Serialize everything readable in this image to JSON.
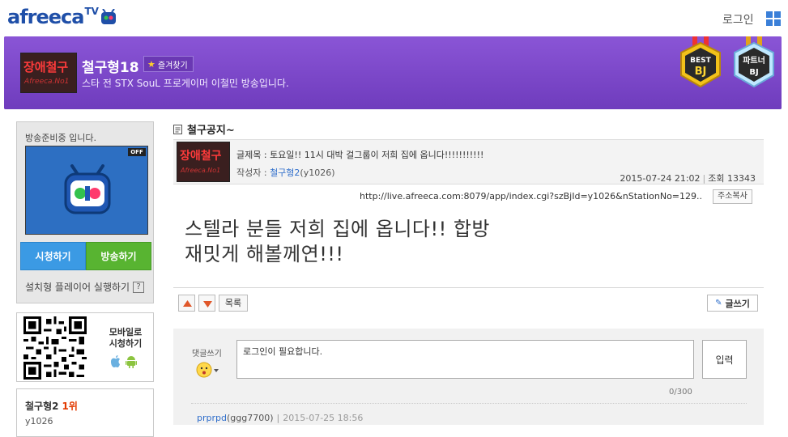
{
  "header": {
    "logo_text": "afreeca",
    "logo_tv": "TV",
    "login_label": "로그인"
  },
  "channel": {
    "thumb_line1": "장애철구",
    "thumb_line2": "Afreeca.No1",
    "name": "철구형18",
    "favorite_label": "즐겨찾기",
    "description": "스타 전 STX SouL 프로게이머 이철민 방송입니다.",
    "badge_best_line1": "BEST",
    "badge_best_line2": "BJ",
    "badge_partner_line1": "파트너",
    "badge_partner_line2": "BJ"
  },
  "sidebar": {
    "player_status": "방송준비중 입니다.",
    "off_label": "OFF",
    "watch_label": "시청하기",
    "broadcast_label": "방송하기",
    "install_player_label": "설치형 플레이어 실행하기",
    "help_label": "?",
    "mobile_line1": "모바일로",
    "mobile_line2": "시청하기",
    "rank_name": "철구형2",
    "rank_position": "1위",
    "rank_id": "y1026"
  },
  "board": {
    "title": "철구공지~",
    "subject_label": "글제목 : ",
    "subject": "토요일!! 11시 대박 걸그룹이 저희 집에 옵니다!!!!!!!!!!!",
    "author_label": "작성자 : ",
    "author_nick": "철구형2",
    "author_id": "(y1026)",
    "date": "2015-07-24 21:02",
    "views_label": "조회",
    "views": "13343",
    "url": "http://live.afreeca.com:8079/app/index.cgi?szBjId=y1026&nStationNo=129..",
    "copy_label": "주소복사",
    "body_line1": "스텔라 분들 저희 집에 옵니다!! 합방",
    "body_line2": "재밋게 해볼께연!!!",
    "list_label": "목록",
    "write_label": "글쓰기"
  },
  "comment": {
    "label": "댓글쓰기",
    "placeholder": "로그인이 필요합니다.",
    "submit_label": "입력",
    "char_count": "0/300",
    "first_author_nick": "prprpd",
    "first_author_id": "(ggg7700)",
    "first_date": "2015-07-25 18:56"
  },
  "colors": {
    "brand": "#1f4fa8",
    "banner": "#7b45c9",
    "watch": "#3b9ae4",
    "broadcast": "#58b431",
    "rank": "#e23a00",
    "link": "#2f6ecb"
  }
}
